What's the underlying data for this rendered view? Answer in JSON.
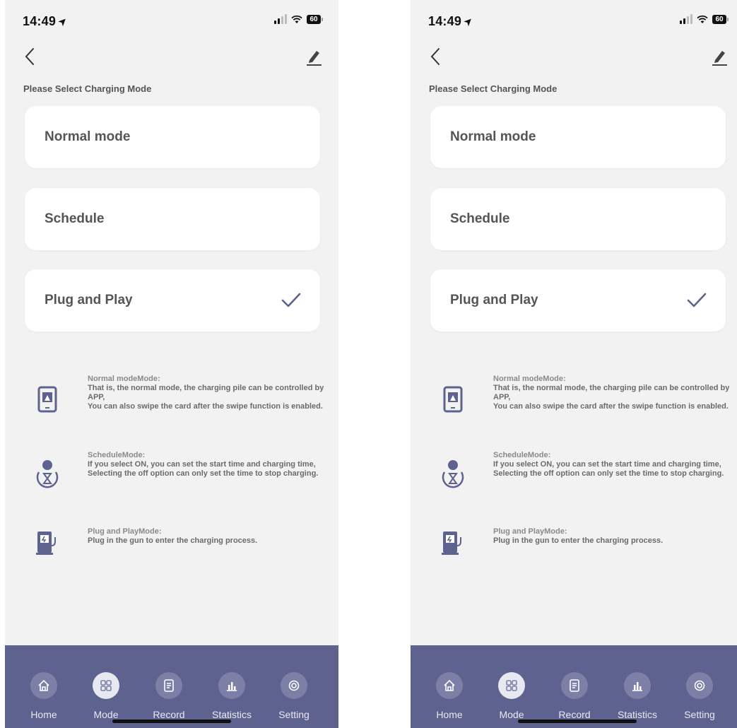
{
  "phones": [
    {
      "status": {
        "time": "14:49",
        "battery": "60"
      },
      "subtitle": "Please Select Charging Mode",
      "modes": [
        {
          "label": "Normal mode",
          "selected": false
        },
        {
          "label": "Schedule",
          "selected": false
        },
        {
          "label": "Plug and Play",
          "selected": true
        }
      ],
      "descriptions": [
        {
          "title": "Normal modeMode:",
          "lines": [
            "That is, the normal mode, the charging pile can be controlled by APP,",
            "You can also swipe the card after the swipe function is enabled."
          ]
        },
        {
          "title": "ScheduleMode:",
          "lines": [
            "If you select ON, you can set the start time and charging time,",
            "Selecting the off option can only set the time to stop charging."
          ]
        },
        {
          "title": "Plug and PlayMode:",
          "lines": [
            "Plug in the gun to enter the charging process."
          ]
        }
      ],
      "tabs": [
        {
          "label": "Home",
          "icon": "home-icon",
          "active": false
        },
        {
          "label": "Mode",
          "icon": "grid-icon",
          "active": true
        },
        {
          "label": "Record",
          "icon": "document-icon",
          "active": false
        },
        {
          "label": "Statistics",
          "icon": "bar-chart-icon",
          "active": false
        },
        {
          "label": "Setting",
          "icon": "gear-icon",
          "active": false
        }
      ]
    },
    {
      "status": {
        "time": "14:49",
        "battery": "60"
      },
      "subtitle": "Please Select Charging Mode",
      "modes": [
        {
          "label": "Normal mode",
          "selected": false
        },
        {
          "label": "Schedule",
          "selected": false
        },
        {
          "label": "Plug and Play",
          "selected": true
        }
      ],
      "descriptions": [
        {
          "title": "Normal modeMode:",
          "lines": [
            "That is, the normal mode, the charging pile can be controlled by APP,",
            "You can also swipe the card after the swipe function is enabled."
          ]
        },
        {
          "title": "ScheduleMode:",
          "lines": [
            "If you select ON, you can set the start time and charging time,",
            "Selecting the off option can only set the time to stop charging."
          ]
        },
        {
          "title": "Plug and PlayMode:",
          "lines": [
            "Plug in the gun to enter the charging process."
          ]
        }
      ],
      "tabs": [
        {
          "label": "Home",
          "icon": "home-icon",
          "active": false
        },
        {
          "label": "Mode",
          "icon": "grid-icon",
          "active": true
        },
        {
          "label": "Record",
          "icon": "document-icon",
          "active": false
        },
        {
          "label": "Statistics",
          "icon": "bar-chart-icon",
          "active": false
        },
        {
          "label": "Setting",
          "icon": "gear-icon",
          "active": false
        }
      ]
    }
  ],
  "colors": {
    "accent": "#5d628f",
    "check": "#5d628f",
    "background": "#f2f2f2",
    "card": "#ffffff",
    "active_tab_circle": "#e7e8f1",
    "inactive_tab_circle": "#7c80a6"
  }
}
